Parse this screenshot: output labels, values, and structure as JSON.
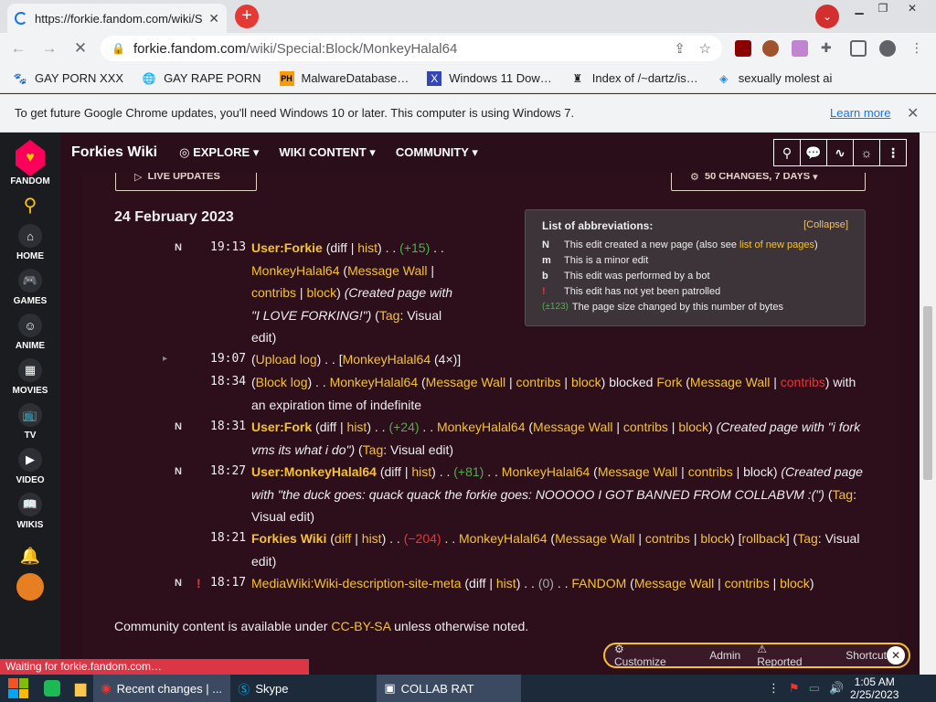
{
  "browser": {
    "tab_title": "https://forkie.fandom.com/wiki/S",
    "url_domain": "forkie.fandom.com",
    "url_path": "/wiki/Special:Block/MonkeyHalal64",
    "bookmarks": [
      "GAY PORN XXX",
      "GAY RAPE PORN",
      "MalwareDatabase…",
      "Windows 11 Dow…",
      "Index of /~dartz/is…",
      "sexually molest ai"
    ],
    "infobar_text": "To get future Google Chrome updates, you'll need Windows 10 or later. This computer is using Windows 7.",
    "infobar_link": "Learn more"
  },
  "rail": [
    {
      "label": "FANDOM",
      "icon": "fandom-logo-icon"
    },
    {
      "label": "HOME",
      "icon": "home-icon"
    },
    {
      "label": "GAMES",
      "icon": "games-icon"
    },
    {
      "label": "ANIME",
      "icon": "anime-icon"
    },
    {
      "label": "MOVIES",
      "icon": "movies-icon"
    },
    {
      "label": "TV",
      "icon": "tv-icon"
    },
    {
      "label": "VIDEO",
      "icon": "video-icon"
    },
    {
      "label": "WIKIS",
      "icon": "wikis-icon"
    }
  ],
  "topnav": {
    "wiki_name": "Forkies Wiki",
    "explore": "EXPLORE",
    "wiki_content": "WIKI CONTENT",
    "community": "COMMUNITY"
  },
  "controls": {
    "live_updates": "LIVE UPDATES",
    "changes_filter": "50 CHANGES, 7 DAYS"
  },
  "date_heading": "24 February 2023",
  "abbreviations": {
    "title": "List of abbreviations:",
    "collapse": "Collapse",
    "rows": [
      {
        "k": "N",
        "v": "This edit created a new page (also see ",
        "link": "list of new pages",
        "end": ")"
      },
      {
        "k": "m",
        "v": "This is a minor edit",
        "link": "",
        "end": ""
      },
      {
        "k": "b",
        "v": "This edit was performed by a bot",
        "link": "",
        "end": ""
      },
      {
        "k": "!",
        "v": "This edit has not yet been patrolled",
        "link": "",
        "end": ""
      },
      {
        "k": "(±123)",
        "v": "The page size changed by this number of bytes",
        "link": "",
        "end": ""
      }
    ]
  },
  "entries": [
    {
      "flag": "N",
      "time": "19:13",
      "page": "User:Forkie",
      "delta": "(+15)",
      "user": "MonkeyHalal64",
      "summary": "(Created page with \"I LOVE FORKING!\")",
      "tag": "Visual edit"
    },
    {
      "flag": "",
      "time": "19:07",
      "log": "Upload log",
      "user": "MonkeyHalal64",
      "count": "(4×)"
    },
    {
      "flag": "",
      "time": "18:34",
      "log": "Block log",
      "user": "MonkeyHalal64",
      "target": "Fork",
      "action": "blocked",
      "tail": "with an expiration time of indefinite"
    },
    {
      "flag": "N",
      "time": "18:31",
      "page": "User:Fork",
      "delta": "(+24)",
      "user": "MonkeyHalal64",
      "summary": "(Created page with \"i fork vms its what i do\")",
      "tag": "Visual edit"
    },
    {
      "flag": "N",
      "time": "18:27",
      "page": "User:MonkeyHalal64",
      "delta": "(+81)",
      "user": "MonkeyHalal64",
      "summary": "(Created page with \"the duck goes: quack quack the forkie goes: NOOOOO I GOT BANNED FROM COLLABVM :(\")",
      "tag": "Visual edit"
    },
    {
      "flag": "",
      "time": "18:21",
      "page": "Forkies Wiki",
      "delta": "(−204)",
      "user": "MonkeyHalal64",
      "rollback": "rollback",
      "tag": "Visual edit"
    },
    {
      "flag": "N !",
      "time": "18:17",
      "page": "MediaWiki:Wiki-description-site-meta",
      "delta": "(0)",
      "user": "FANDOM"
    }
  ],
  "footer": {
    "pre": "Community content is available under ",
    "link": "CC-BY-SA",
    "post": " unless otherwise noted."
  },
  "fixed_toolbar": {
    "customize": "Customize",
    "admin": "Admin",
    "reported": "Reported",
    "shortcuts": "Shortcuts"
  },
  "status_bar": "Waiting for forkie.fandom.com…",
  "taskbar": {
    "apps": [
      "Recent changes | ...",
      "Skype",
      "COLLAB RAT"
    ],
    "time": "1:05 AM",
    "date": "2/25/2023"
  }
}
